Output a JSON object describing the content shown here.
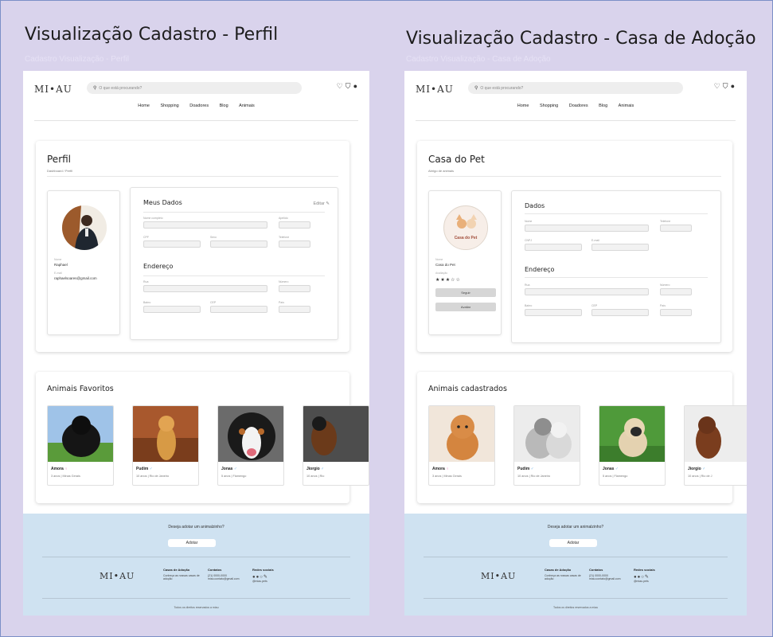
{
  "boards": [
    {
      "title": "Visualização Cadastro - Perfil",
      "subtitle": "Cadastro Visualização - Perfil"
    },
    {
      "title": "Visualização Cadastro - Casa de Adoção",
      "subtitle": "Cadastro Visualização - Casa de Adoção"
    }
  ],
  "header": {
    "logo": "MI•AU",
    "search_placeholder": "O que está procurando?",
    "icons": [
      "heart-icon",
      "bag-icon",
      "user-icon"
    ],
    "nav": [
      "Home",
      "Shopping",
      "Doadores",
      "Blog",
      "Animais"
    ]
  },
  "profile": {
    "title": "Perfil",
    "breadcrumb": "Dashboard / Perfil",
    "side": {
      "name_label": "Nome",
      "name": "Raphael",
      "email_label": "E-mail",
      "email": "raphaelsoares@gmail.com"
    },
    "data_title": "Meus Dados",
    "edit": "Editar ✎",
    "fields1": [
      "Nome completo",
      "Apelido",
      "CPF",
      "Sexo",
      "Telefone"
    ],
    "address_title": "Endereço",
    "fields2": [
      "Rua",
      "Número",
      "Bairro",
      "CEP",
      "País"
    ],
    "favorites_title": "Animais Favoritos",
    "pets": [
      {
        "name": "Amora",
        "gender": "♀",
        "gender_color": "#e27bb8",
        "info": "3 anos | Minas Gerais"
      },
      {
        "name": "Pudim",
        "gender": "♂",
        "gender_color": "#5aa7e0",
        "info": "10 anos | Rio de Janeiro"
      },
      {
        "name": "Jonas",
        "gender": "♂",
        "gender_color": "#5aa7e0",
        "info": "5 anos | Flamengo"
      },
      {
        "name": "Jiorgio",
        "gender": "♂",
        "gender_color": "#5aa7e0",
        "info": "10 anos | Rio"
      }
    ]
  },
  "shelter": {
    "title": "Casa do Pet",
    "breadcrumb": "Abrigo de animais",
    "logo_text": "Casa do Pet",
    "side": {
      "name_label": "Nome",
      "name": "Casa do Pet",
      "rating_label": "Avaliação",
      "stars": "★★★☆☆",
      "btn1": "Seguir",
      "btn2": "Avaliar"
    },
    "data_title": "Dados",
    "fields1": [
      "Nome",
      "Telefone",
      "CNPJ",
      "E-mail"
    ],
    "address_title": "Endereço",
    "fields2": [
      "Rua",
      "Número",
      "Bairro",
      "CEP",
      "País"
    ],
    "animals_title": "Animais cadastrados",
    "pets": [
      {
        "name": "Amora",
        "gender": "♀",
        "gender_color": "#e27bb8",
        "info": "3 anos | Minas Gerais"
      },
      {
        "name": "Pudim",
        "gender": "♂",
        "gender_color": "#5aa7e0",
        "info": "10 anos | Rio de Janeiro"
      },
      {
        "name": "Jonas",
        "gender": "♂",
        "gender_color": "#5aa7e0",
        "info": "5 anos | Flamengo"
      },
      {
        "name": "Jiorgio",
        "gender": "♂",
        "gender_color": "#5aa7e0",
        "info": "10 anos | Rio de J"
      }
    ]
  },
  "footer": {
    "question": "Deseja adotar um animalzinho?",
    "button": "Adotar",
    "logo": "MI•AU",
    "col1_title": "Casas de Adoção",
    "col1_text": "Conheça as nossas casas de adoção",
    "col2_title": "Contatos",
    "col2_text": "(21) 0000-0000 miau.contato@gmail.com",
    "col3_title": "Redes sociais",
    "col3_text": "@miau.pets",
    "copyright": "Todos os direitos reservados a miau"
  }
}
